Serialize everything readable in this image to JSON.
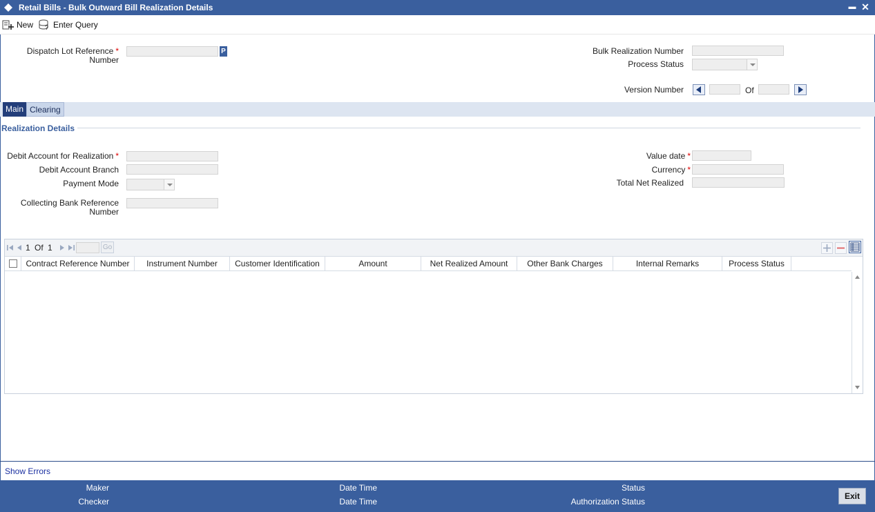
{
  "window": {
    "title": "Retail Bills - Bulk Outward Bill Realization Details",
    "minimize_label": "▬",
    "close_label": "✕"
  },
  "toolbar": {
    "new_label": "New",
    "enter_query_label": "Enter Query"
  },
  "header": {
    "dispatch_lot_label": "Dispatch Lot Reference",
    "dispatch_lot_label2": "Number",
    "dispatch_lot_value": "",
    "pick_label": "P",
    "bulk_realization_label": "Bulk Realization Number",
    "bulk_realization_value": "",
    "process_status_label": "Process Status",
    "process_status_value": "",
    "version_label": "Version Number",
    "version_of_label": "Of",
    "version_current": "",
    "version_total": ""
  },
  "tabs": [
    {
      "label": "Main"
    },
    {
      "label": "Clearing"
    }
  ],
  "realization": {
    "section_title": "Realization Details",
    "debit_account_label": "Debit Account for Realization",
    "debit_branch_label": "Debit Account Branch",
    "payment_mode_label": "Payment Mode",
    "collecting_ref_label": "Collecting Bank Reference",
    "collecting_ref_label2": "Number",
    "value_date_label": "Value date",
    "currency_label": "Currency",
    "total_net_label": "Total Net Realized"
  },
  "grid": {
    "page_current": "1",
    "page_of": "Of",
    "page_total": "1",
    "go_label": "Go",
    "columns": [
      "Contract Reference Number",
      "Instrument Number",
      "Customer Identification",
      "Amount",
      "Net Realized Amount",
      "Other Bank Charges",
      "Internal Remarks",
      "Process Status"
    ]
  },
  "show_errors_label": "Show Errors",
  "footer": {
    "maker_label": "Maker",
    "checker_label": "Checker",
    "date_time_label_1": "Date Time",
    "date_time_label_2": "Date Time",
    "status_label": "Status",
    "auth_status_label": "Authorization Status",
    "exit_label": "Exit"
  },
  "colors": {
    "primary": "#3a5f9e",
    "tab_active": "#233e7a",
    "required": "#dd0000",
    "link": "#1a2fa0"
  }
}
